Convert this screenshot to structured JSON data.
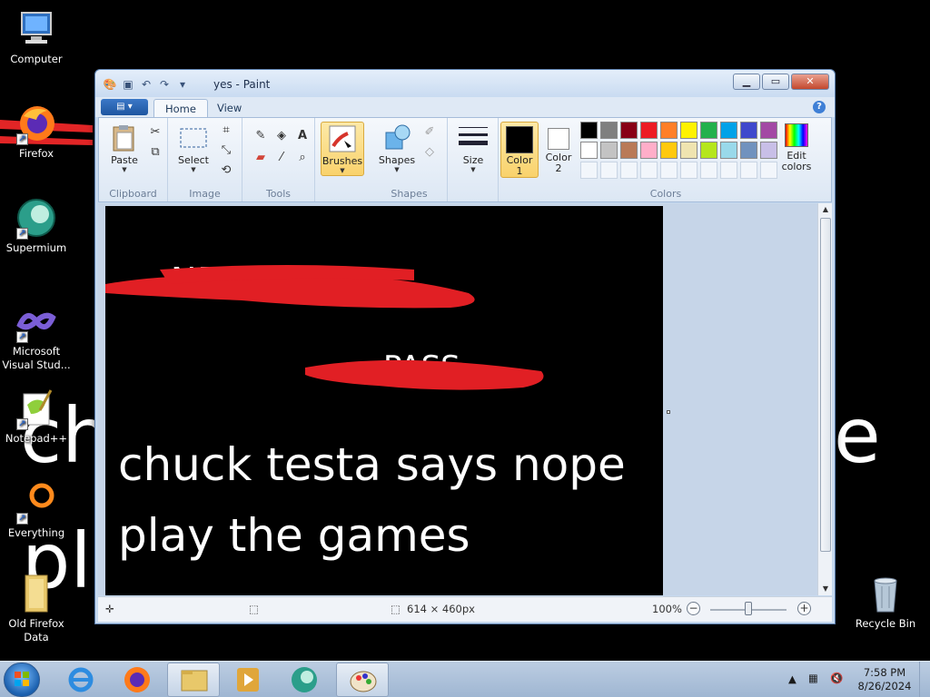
{
  "desktop": {
    "wallpaper_text": {
      "ch": "ch",
      "e": "e",
      "pl": "pl"
    },
    "icons": [
      {
        "label": "Computer",
        "icon": "computer-icon"
      },
      {
        "label": "Firefox",
        "icon": "firefox-icon"
      },
      {
        "label": "Supermium",
        "icon": "supermium-icon"
      },
      {
        "label": "Microsoft Visual Stud...",
        "icon": "visual-studio-icon"
      },
      {
        "label": "Notepad++",
        "icon": "notepadpp-icon"
      },
      {
        "label": "Everything",
        "icon": "everything-icon"
      },
      {
        "label": "Old Firefox Data",
        "icon": "folder-icon"
      },
      {
        "label": "Recycle Bin",
        "icon": "recycle-bin-icon"
      }
    ]
  },
  "window": {
    "title": "yes - Paint",
    "tabs": {
      "home": "Home",
      "view": "View"
    },
    "ribbon": {
      "paste": "Paste",
      "select": "Select",
      "brushes": "Brushes",
      "shapes": "Shapes",
      "size": "Size",
      "color1": "Color\n1",
      "color1_a": "Color",
      "color1_b": "1",
      "color2_a": "Color",
      "color2_b": "2",
      "edit_colors_a": "Edit",
      "edit_colors_b": "colors",
      "groups": {
        "clipboard": "Clipboard",
        "image": "Image",
        "tools": "Tools",
        "shapes": "Shapes",
        "colors": "Colors"
      },
      "color1_value": "#000000",
      "color2_value": "#ffffff",
      "palette_row1": [
        "#000000",
        "#7f7f7f",
        "#880015",
        "#ed1c24",
        "#ff7f27",
        "#fff200",
        "#22b14c",
        "#00a2e8",
        "#3f48cc",
        "#a349a4"
      ],
      "palette_row2": [
        "#ffffff",
        "#c3c3c3",
        "#b97a57",
        "#ffaec9",
        "#ffc90e",
        "#efe4b0",
        "#b5e61d",
        "#99d9ea",
        "#7092be",
        "#c8bfe7"
      ]
    },
    "canvas": {
      "line1": "chuck testa says nope",
      "line2": "play the games",
      "scribble_text_1": "NETWORK",
      "scribble_text_2": "PASS"
    },
    "status": {
      "size": "614 × 460px",
      "zoom": "100%"
    }
  },
  "taskbar": {
    "time": "7:58 PM",
    "date": "8/26/2024"
  }
}
